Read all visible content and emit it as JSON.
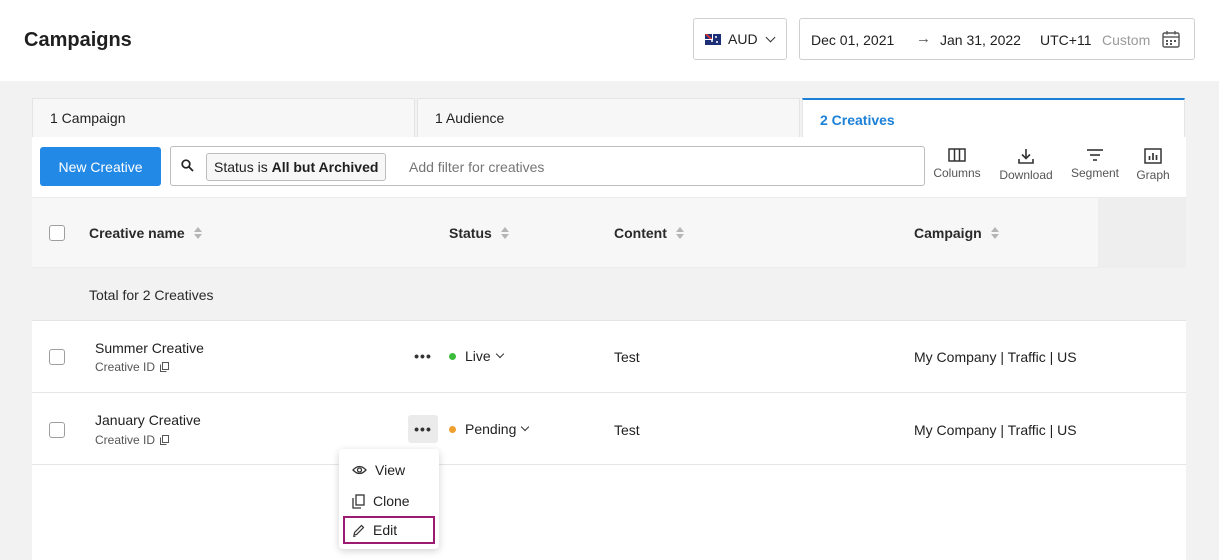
{
  "header": {
    "title": "Campaigns",
    "currency": "AUD",
    "date_start": "Dec 01, 2021",
    "date_arrow": "→",
    "date_end": "Jan 31, 2022",
    "timezone": "UTC+11",
    "range_type": "Custom"
  },
  "tabs": [
    {
      "label": "1 Campaign"
    },
    {
      "label": "1 Audience"
    },
    {
      "label": "2 Creatives"
    }
  ],
  "toolbar": {
    "new_button": "New Creative",
    "filter_prefix": "Status is",
    "filter_value": "All but Archived",
    "filter_placeholder": "Add filter for creatives",
    "tools": [
      "Columns",
      "Download",
      "Segment",
      "Graph"
    ]
  },
  "table": {
    "columns": [
      "Creative name",
      "Status",
      "Content",
      "Campaign"
    ],
    "total_label": "Total for 2 Creatives",
    "id_label": "Creative ID",
    "rows": [
      {
        "name": "Summer Creative",
        "status": "Live",
        "content": "Test",
        "campaign": "My Company | Traffic | US"
      },
      {
        "name": "January Creative",
        "status": "Pending",
        "content": "Test",
        "campaign": "My Company | Traffic | US"
      }
    ]
  },
  "menu": {
    "items": [
      "View",
      "Clone",
      "Edit"
    ]
  },
  "colors": {
    "accent": "#2389e6",
    "live": "#3dbb3d",
    "pending": "#f0a030",
    "highlight": "#9c1a72"
  }
}
